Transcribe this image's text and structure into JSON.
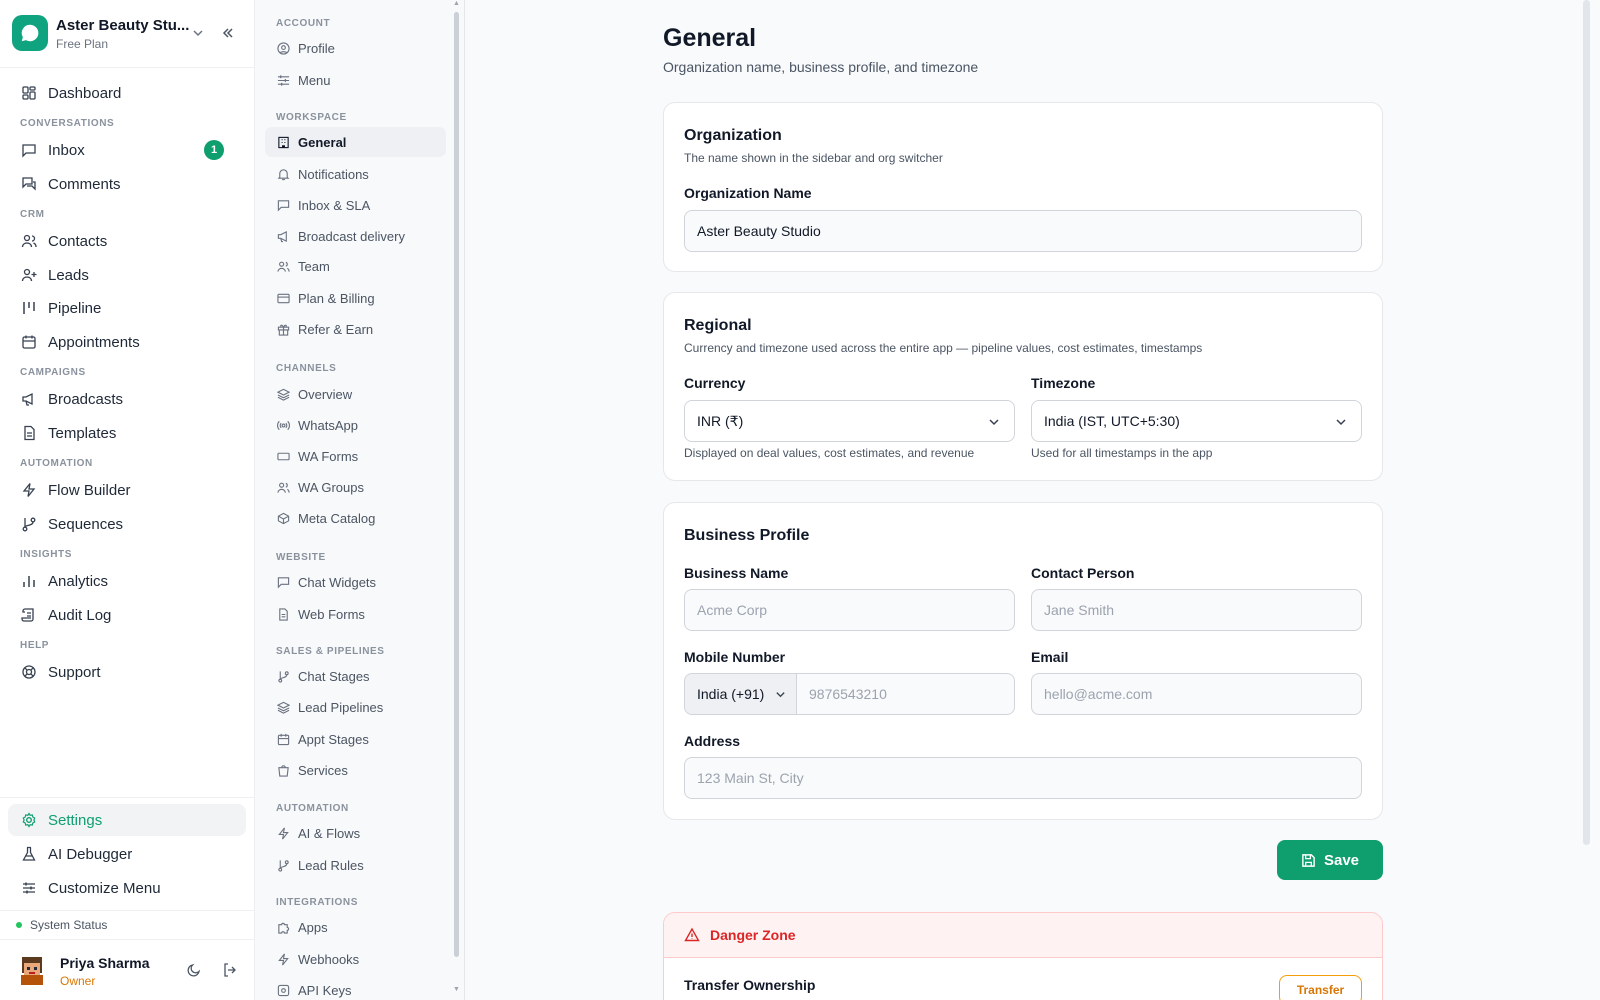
{
  "org": {
    "name": "Aster Beauty Stu...",
    "plan": "Free Plan"
  },
  "sidebar": {
    "dashboard": "Dashboard",
    "sections": {
      "conversations": "CONVERSATIONS",
      "crm": "CRM",
      "campaigns": "CAMPAIGNS",
      "automation": "AUTOMATION",
      "insights": "INSIGHTS",
      "help": "HELP"
    },
    "items": {
      "inbox": "Inbox",
      "inbox_badge": "1",
      "comments": "Comments",
      "contacts": "Contacts",
      "leads": "Leads",
      "pipeline": "Pipeline",
      "appointments": "Appointments",
      "broadcasts": "Broadcasts",
      "templates": "Templates",
      "flow_builder": "Flow Builder",
      "sequences": "Sequences",
      "analytics": "Analytics",
      "audit_log": "Audit Log",
      "support": "Support"
    },
    "bottom": {
      "settings": "Settings",
      "ai_debugger": "AI Debugger",
      "customize_menu": "Customize Menu"
    },
    "system_status": "System Status",
    "user": {
      "name": "Priya Sharma",
      "role": "Owner"
    }
  },
  "subnav": {
    "sections": {
      "account": "ACCOUNT",
      "workspace": "WORKSPACE",
      "channels": "CHANNELS",
      "website": "WEBSITE",
      "sales": "SALES & PIPELINES",
      "automation": "AUTOMATION",
      "integrations": "INTEGRATIONS"
    },
    "items": {
      "profile": "Profile",
      "menu": "Menu",
      "general": "General",
      "notifications": "Notifications",
      "inbox_sla": "Inbox & SLA",
      "broadcast_delivery": "Broadcast delivery",
      "team": "Team",
      "plan_billing": "Plan & Billing",
      "refer_earn": "Refer & Earn",
      "overview": "Overview",
      "whatsapp": "WhatsApp",
      "wa_forms": "WA Forms",
      "wa_groups": "WA Groups",
      "meta_catalog": "Meta Catalog",
      "chat_widgets": "Chat Widgets",
      "web_forms": "Web Forms",
      "chat_stages": "Chat Stages",
      "lead_pipelines": "Lead Pipelines",
      "appt_stages": "Appt Stages",
      "services": "Services",
      "ai_flows": "AI & Flows",
      "lead_rules": "Lead Rules",
      "apps": "Apps",
      "webhooks": "Webhooks",
      "api_keys": "API Keys"
    }
  },
  "page": {
    "title": "General",
    "subtitle": "Organization name, business profile, and timezone"
  },
  "organization": {
    "title": "Organization",
    "subtitle": "The name shown in the sidebar and org switcher",
    "name_label": "Organization Name",
    "name_value": "Aster Beauty Studio"
  },
  "regional": {
    "title": "Regional",
    "subtitle": "Currency and timezone used across the entire app — pipeline values, cost estimates, timestamps",
    "currency_label": "Currency",
    "currency_value": "INR (₹)",
    "currency_hint": "Displayed on deal values, cost estimates, and revenue",
    "timezone_label": "Timezone",
    "timezone_value": "India (IST, UTC+5:30)",
    "timezone_hint": "Used for all timestamps in the app"
  },
  "business": {
    "title": "Business Profile",
    "business_name_label": "Business Name",
    "business_name_placeholder": "Acme Corp",
    "contact_label": "Contact Person",
    "contact_placeholder": "Jane Smith",
    "mobile_label": "Mobile Number",
    "country_code": "India (+91)",
    "mobile_placeholder": "9876543210",
    "email_label": "Email",
    "email_placeholder": "hello@acme.com",
    "address_label": "Address",
    "address_placeholder": "123 Main St, City"
  },
  "save_label": "Save",
  "danger": {
    "title": "Danger Zone",
    "transfer_label": "Transfer Ownership",
    "transfer_button": "Transfer"
  },
  "colors": {
    "accent": "#0f9f6e",
    "danger": "#dc2626",
    "warning": "#d97706"
  }
}
